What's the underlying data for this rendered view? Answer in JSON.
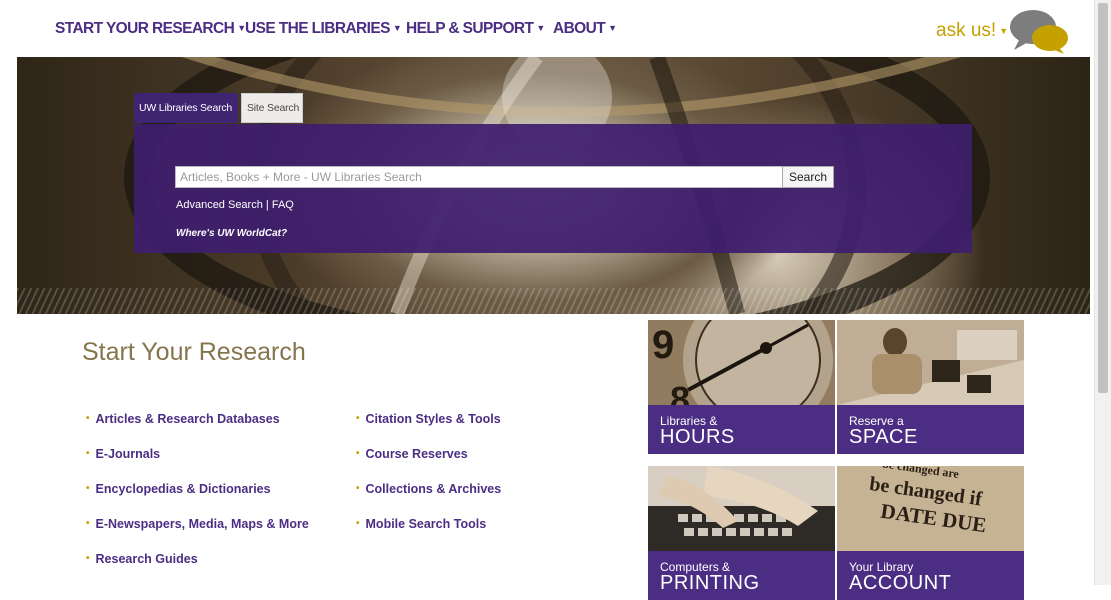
{
  "nav": {
    "items": [
      {
        "label": "START YOUR RESEARCH"
      },
      {
        "label": "USE THE LIBRARIES"
      },
      {
        "label": "HELP & SUPPORT"
      },
      {
        "label": "ABOUT"
      }
    ],
    "ask_us": "ask us!"
  },
  "search": {
    "tabs": [
      "UW Libraries Search",
      "Site Search"
    ],
    "placeholder": "Articles, Books + More - UW Libraries Search",
    "button": "Search",
    "advanced": "Advanced Search",
    "separator": "|",
    "faq": "FAQ",
    "worldcat": "Where's UW WorldCat?"
  },
  "research": {
    "title": "Start Your Research",
    "col1": [
      "Articles & Research Databases",
      "E-Journals",
      "Encyclopedias & Dictionaries",
      "E-Newspapers, Media, Maps & More",
      "Research Guides"
    ],
    "col2": [
      "Citation Styles & Tools",
      "Course Reserves",
      "Collections & Archives",
      "Mobile Search Tools"
    ]
  },
  "tiles": [
    {
      "small": "Libraries &",
      "big": "HOURS",
      "icon": "clock-photo"
    },
    {
      "small": "Reserve a",
      "big": "SPACE",
      "icon": "study-room-photo"
    },
    {
      "small": "Computers &",
      "big": "PRINTING",
      "icon": "keyboard-photo"
    },
    {
      "small": "Your Library",
      "big": "ACCOUNT",
      "icon": "due-date-stamp-photo"
    }
  ],
  "colors": {
    "purple": "#4b2e83",
    "gold": "#c5a100",
    "title_gold": "#85754d"
  }
}
